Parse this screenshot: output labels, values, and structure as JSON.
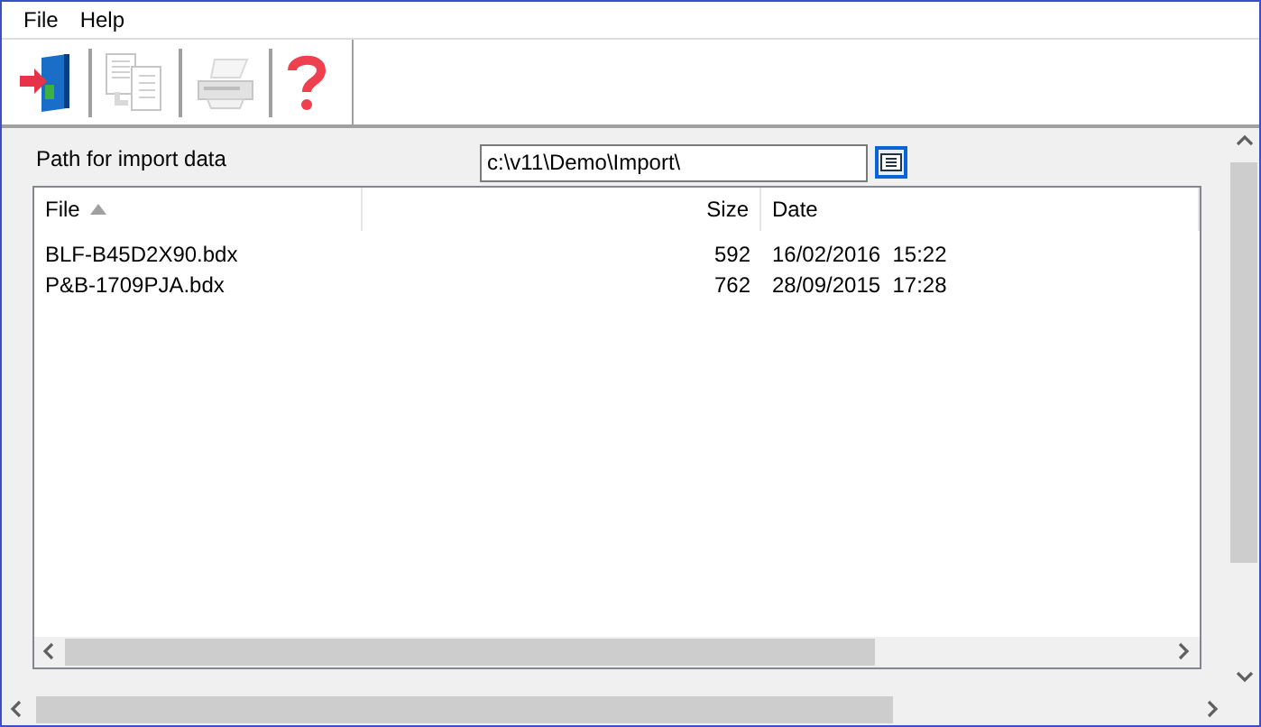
{
  "menu": [
    "File",
    "Help"
  ],
  "toolbar": [
    {
      "kind": "import",
      "disabled": false
    },
    {
      "kind": "copy",
      "disabled": true
    },
    {
      "kind": "print",
      "disabled": true
    },
    {
      "kind": "help",
      "disabled": false
    }
  ],
  "path": {
    "label": "Path for import data",
    "value": "c:\\v11\\Demo\\Import\\"
  },
  "table": {
    "columns": [
      {
        "label": "File",
        "sorted": true
      },
      {
        "label": "Size",
        "sorted": false
      },
      {
        "label": "Date",
        "sorted": false
      }
    ],
    "rows": [
      [
        "BLF-B45D2X90.bdx",
        "592",
        "16/02/2016  15:22"
      ],
      [
        "P&B-1709PJA.bdx",
        "762",
        "28/09/2015  17:28"
      ]
    ]
  }
}
